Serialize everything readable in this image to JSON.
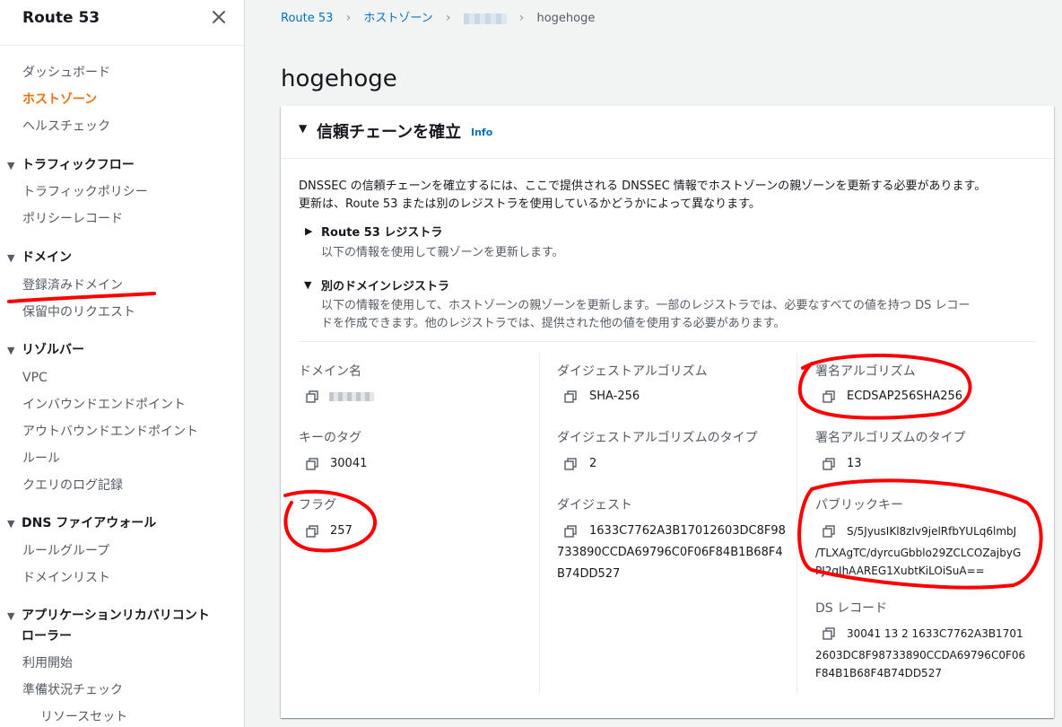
{
  "sidebar": {
    "title": "Route 53",
    "close_icon": "close-icon",
    "items": [
      {
        "label": "ダッシュボード",
        "kind": "item"
      },
      {
        "label": "ホストゾーン",
        "kind": "item",
        "active": true
      },
      {
        "label": "ヘルスチェック",
        "kind": "item"
      },
      {
        "label": "トラフィックフロー",
        "kind": "section"
      },
      {
        "label": "トラフィックポリシー",
        "kind": "item"
      },
      {
        "label": "ポリシーレコード",
        "kind": "item"
      },
      {
        "label": "ドメイン",
        "kind": "section"
      },
      {
        "label": "登録済みドメイン",
        "kind": "item"
      },
      {
        "label": "保留中のリクエスト",
        "kind": "item"
      },
      {
        "label": "リゾルバー",
        "kind": "section"
      },
      {
        "label": "VPC",
        "kind": "item"
      },
      {
        "label": "インバウンドエンドポイント",
        "kind": "item"
      },
      {
        "label": "アウトバウンドエンドポイント",
        "kind": "item"
      },
      {
        "label": "ルール",
        "kind": "item"
      },
      {
        "label": "クエリのログ記録",
        "kind": "item"
      },
      {
        "label": "DNS ファイアウォール",
        "kind": "section"
      },
      {
        "label": "ルールグループ",
        "kind": "item"
      },
      {
        "label": "ドメインリスト",
        "kind": "item"
      },
      {
        "label": "アプリケーションリカバリコント",
        "label2": "ローラー",
        "kind": "section"
      },
      {
        "label": "利用開始",
        "kind": "item"
      },
      {
        "label": "準備状況チェック",
        "kind": "item"
      },
      {
        "label": "リソースセット",
        "kind": "subitem"
      }
    ]
  },
  "breadcrumb": {
    "items": [
      "Route 53",
      "ホストゾーン",
      "hogehoge"
    ]
  },
  "page_title": "hogehoge",
  "panel": {
    "title": "信頼チェーンを確立",
    "info": "Info",
    "description_1": "DNSSEC の信頼チェーンを確立するには、ここで提供される DNSSEC 情報でホストゾーンの親ゾーンを更新する必要があります。",
    "description_2": "更新は、Route 53 または別のレジストラを使用しているかどうかによって異なります。",
    "route53_registrar": {
      "title": "Route 53 レジストラ",
      "body": "以下の情報を使用して親ゾーンを更新します。",
      "expanded": false
    },
    "other_registrar": {
      "title": "別のドメインレジストラ",
      "body_1": "以下の情報を使用して、ホストゾーンの親ゾーンを更新します。一部のレジストラでは、必要なすべての値を持つ DS レコー",
      "body_2": "ドを作成できます。他のレジストラでは、提供された他の値を使用する必要があります。",
      "expanded": true
    },
    "fields": {
      "domain_name": {
        "label": "ドメイン名"
      },
      "key_tag": {
        "label": "キーのタグ",
        "value": "30041"
      },
      "flag": {
        "label": "フラグ",
        "value": "257"
      },
      "digest_algorithm": {
        "label": "ダイジェストアルゴリズム",
        "value": "SHA-256"
      },
      "digest_algorithm_type": {
        "label": "ダイジェストアルゴリズムのタイプ",
        "value": "2"
      },
      "digest": {
        "label": "ダイジェスト",
        "value_line1": "1633C7762A3B17012603DC8F98",
        "value_line2": "733890CCDA69796C0F06F84B1B68F4",
        "value_line3": "B74DD527"
      },
      "signing_algorithm": {
        "label": "署名アルゴリズム",
        "value": "ECDSAP256SHA256"
      },
      "signing_algorithm_type": {
        "label": "署名アルゴリズムのタイプ",
        "value": "13"
      },
      "public_key": {
        "label": "パブリックキー",
        "value_line1": "S/5JyusIKl8zIv9jelRfbYULq6lmbJ",
        "value_line2": "/TLXAgTC/dyrcuGbblo29ZCLCOZajbyG",
        "value_line3": "PJ2gIhAAREG1XubtKiLOiSuA=="
      },
      "ds_record": {
        "label": "DS レコード",
        "value_line1": "30041 13 2 1633C7762A3B1701",
        "value_line2": "2603DC8F98733890CCDA69796C0F06",
        "value_line3": "F84B1B68F4B74DD527"
      }
    }
  },
  "colors": {
    "accent_orange": "#ec7211",
    "link_blue": "#0073bb",
    "annotation_red": "#ff0000"
  },
  "icons": {
    "copy": "copy-icon",
    "chevron": "chevron-right-icon",
    "expand": "caret-down-icon",
    "collapse": "caret-right-icon"
  }
}
